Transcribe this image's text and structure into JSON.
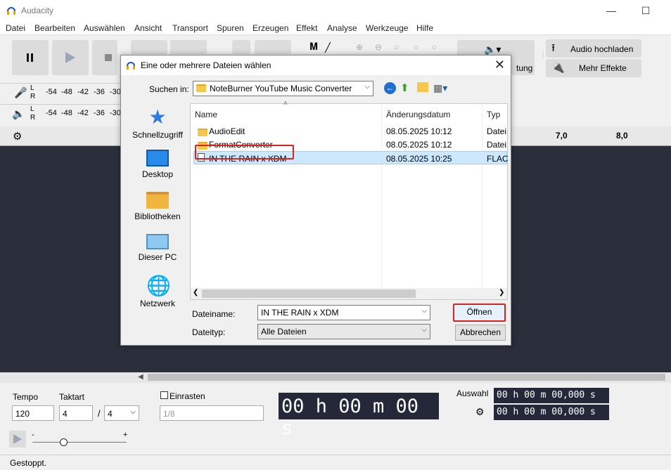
{
  "app": {
    "title": "Audacity",
    "menu": [
      "Datei",
      "Bearbeiten",
      "Auswählen",
      "Ansicht",
      "Transport",
      "Spuren",
      "Erzeugen",
      "Effekt",
      "Analyse",
      "Werkzeuge",
      "Hilfe"
    ],
    "toolbar": {
      "audio_upload": "Audio hochladen",
      "more_effects": "Mehr Effekte",
      "partial_label": "tung"
    },
    "meter": {
      "ticks": [
        "-54",
        "-48",
        "-42",
        "-36",
        "-30"
      ],
      "l": "L",
      "r": "R"
    },
    "ruler": {
      "ticks": [
        "7,0",
        "8,0"
      ]
    },
    "bottom": {
      "tempo_label": "Tempo",
      "tempo_value": "120",
      "taktart_label": "Taktart",
      "taktart_num": "4",
      "taktart_sep": "/",
      "taktart_den": "4",
      "snap_label": "Einrasten",
      "snap_value": "1/8",
      "time_display": "00 h 00 m 00 s",
      "auswahl_label": "Auswahl",
      "sel_start": "00 h 00 m 00,000 s",
      "sel_end": "00 h 00 m 00,000 s",
      "slider_minus": "-",
      "slider_plus": "+"
    },
    "status": "Gestoppt."
  },
  "dialog": {
    "title": "Eine oder mehrere Dateien wählen",
    "look_in_label": "Suchen in:",
    "look_in_value": "NoteBurner YouTube Music Converter",
    "places": [
      "Schnellzugriff",
      "Desktop",
      "Bibliotheken",
      "Dieser PC",
      "Netzwerk"
    ],
    "columns": [
      "Name",
      "Änderungsdatum",
      "Typ"
    ],
    "files": [
      {
        "name": "AudioEdit",
        "date": "08.05.2025 10:12",
        "type": "Datei"
      },
      {
        "name": "FormatConverter",
        "date": "08.05.2025 10:12",
        "type": "Datei"
      },
      {
        "name": "IN THE RAIN x XDM",
        "date": "08.05.2025 10:25",
        "type": "FLAC"
      }
    ],
    "filename_label": "Dateiname:",
    "filename_value": "IN THE RAIN x XDM",
    "filetype_label": "Dateityp:",
    "filetype_value": "Alle Dateien",
    "open_label": "Öffnen",
    "cancel_label": "Abbrechen"
  },
  "colors": {
    "accent": "#0078d7",
    "highlight": "#e0201d",
    "selection": "#cce8ff",
    "track_bg": "#2b2f3b"
  }
}
